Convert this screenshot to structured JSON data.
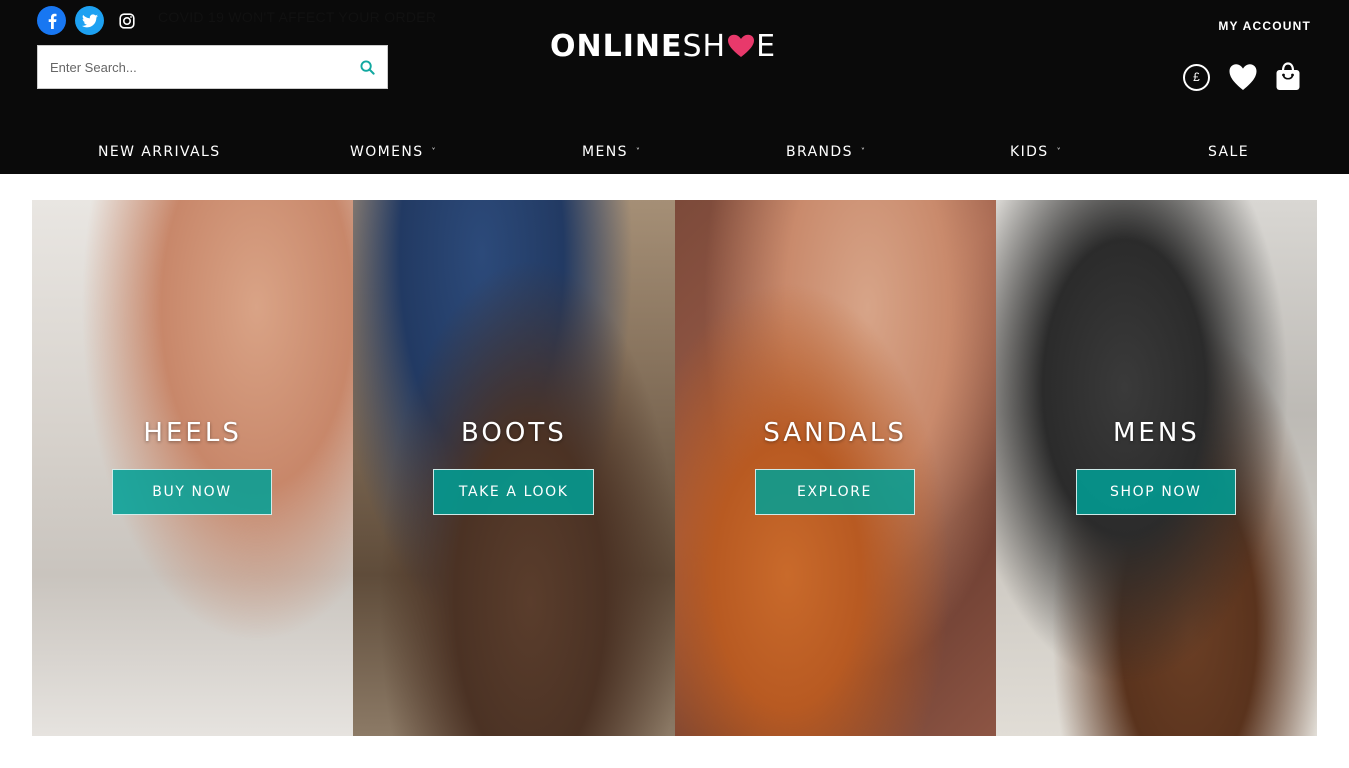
{
  "brand": {
    "logo_bold": "ONLINE",
    "logo_light_1": "SH",
    "logo_light_2": "E",
    "heart_color": "#e8396b"
  },
  "top_banner": {
    "text": "COVID 19 WON'T AFFECT YOUR ORDER",
    "social_icons": [
      "facebook-icon",
      "twitter-icon",
      "instagram-icon"
    ]
  },
  "search": {
    "placeholder": "Enter Search...",
    "value": "",
    "icon": "search-icon",
    "icon_color": "#12a8a0"
  },
  "account": {
    "label": "MY ACCOUNT",
    "currency_symbol": "£",
    "icons": [
      "currency-icon",
      "heart-icon",
      "shopping-bag-icon"
    ]
  },
  "nav": {
    "items": [
      {
        "label": "NEW ARRIVALS",
        "has_dropdown": false
      },
      {
        "label": "WOMENS",
        "has_dropdown": true
      },
      {
        "label": "MENS",
        "has_dropdown": true
      },
      {
        "label": "BRANDS",
        "has_dropdown": true
      },
      {
        "label": "KIDS",
        "has_dropdown": true
      },
      {
        "label": "SALE",
        "has_dropdown": false
      }
    ],
    "chevron": "˅"
  },
  "categories": [
    {
      "title": "HEELS",
      "button": "BUY NOW"
    },
    {
      "title": "BOOTS",
      "button": "TAKE A LOOK"
    },
    {
      "title": "SANDALS",
      "button": "EXPLORE"
    },
    {
      "title": "MENS",
      "button": "SHOP NOW"
    }
  ],
  "colors": {
    "header_bg": "#0a0a0a",
    "accent_teal": "#00a096"
  }
}
